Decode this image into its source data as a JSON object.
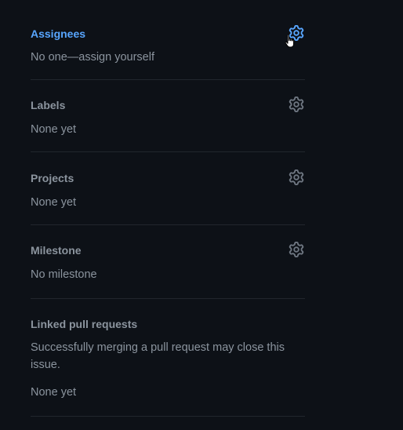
{
  "colors": {
    "background": "#0d1117",
    "heading": "#8b949e",
    "heading_active": "#58a6ff",
    "text": "#8b949e",
    "divider": "#21262d",
    "gear_active": "#58a6ff",
    "gear": "#6e7681"
  },
  "sidebar": {
    "assignees": {
      "title": "Assignees",
      "value": "No one—assign yourself",
      "icon": "gear-icon"
    },
    "labels": {
      "title": "Labels",
      "value": "None yet",
      "icon": "gear-icon"
    },
    "projects": {
      "title": "Projects",
      "value": "None yet",
      "icon": "gear-icon"
    },
    "milestone": {
      "title": "Milestone",
      "value": "No milestone",
      "icon": "gear-icon"
    },
    "linked_prs": {
      "title": "Linked pull requests",
      "description": "Successfully merging a pull request may close this issue.",
      "value": "None yet"
    }
  },
  "cursor": "hand-pointer-cursor"
}
